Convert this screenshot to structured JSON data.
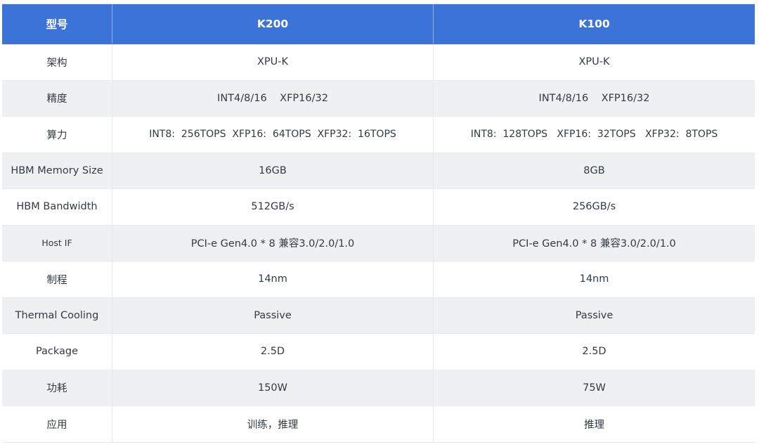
{
  "header": [
    "型号",
    "K200",
    "K100"
  ],
  "rows": [
    [
      "架构",
      "XPU-K",
      "XPU-K"
    ],
    [
      "精度",
      "INT4/8/16    XFP16/32",
      "INT4/8/16    XFP16/32"
    ],
    [
      "算力",
      "INT8:  256TOPS  XFP16:  64TOPS  XFP32:  16TOPS",
      "INT8:  128TOPS   XFP16:  32TOPS   XFP32:  8TOPS"
    ],
    [
      "HBM Memory Size",
      "16GB",
      "8GB"
    ],
    [
      "HBM Bandwidth",
      "512GB/s",
      "256GB/s"
    ],
    [
      "Host IF",
      "PCI-e Gen4.0 * 8 兼容3.0/2.0/1.0",
      "PCI-e Gen4.0 * 8 兼容3.0/2.0/1.0"
    ],
    [
      "制程",
      "14nm",
      "14nm"
    ],
    [
      "Thermal Cooling",
      "Passive",
      "Passive"
    ],
    [
      "Package",
      "2.5D",
      "2.5D"
    ],
    [
      "功耗",
      "150W",
      "75W"
    ],
    [
      "应用",
      "训练，推理",
      "推理"
    ]
  ]
}
